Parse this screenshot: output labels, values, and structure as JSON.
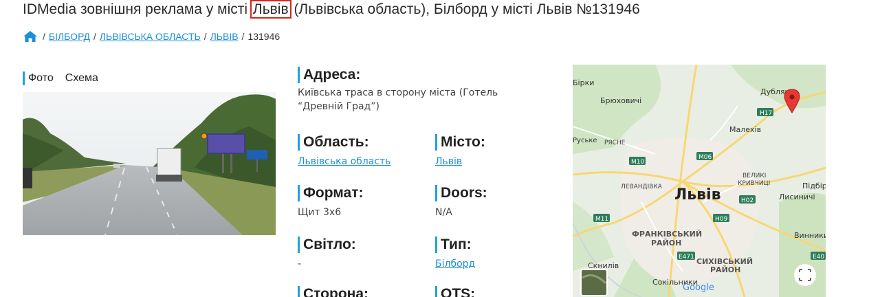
{
  "header": {
    "title_before": "IDMedia зовнішня реклама у місті ",
    "title_highlight": "Львів",
    "title_after": " (Львівська область), Білборд у місті Львів №131946"
  },
  "breadcrumb": {
    "items": [
      "БІЛБОРД",
      "ЛЬВІВСЬКА ОБЛАСТЬ",
      "ЛЬВІВ"
    ],
    "current": "131946",
    "separator": "/"
  },
  "gallery": {
    "tabs": [
      "Фото",
      "Схема"
    ]
  },
  "details": {
    "address": {
      "label": "Адреса:",
      "value": "Київська траса в сторону міста (Готель “Древній Град”)"
    },
    "region": {
      "label": "Область:",
      "value": "Львівська область"
    },
    "city": {
      "label": "Місто:",
      "value": "Львів"
    },
    "format": {
      "label": "Формат:",
      "value": "Щит 3х6"
    },
    "doors": {
      "label": "Doors:",
      "value": "N/A"
    },
    "light": {
      "label": "Світло:",
      "value": "-"
    },
    "type": {
      "label": "Тип:",
      "value": "Білборд"
    },
    "side": {
      "label": "Сторона:"
    },
    "ots": {
      "label": "OTS:"
    }
  },
  "map": {
    "places": {
      "birky": "Бірки",
      "bryukhovychi": "Брюховичі",
      "dublyany": "Дубляни",
      "malekhiv": "Малехів",
      "ruske": "Руське",
      "ryasne": "РЯСНЕ",
      "levandivka": "ЛЕВАНДІВКА",
      "velyki_kryvchytsi_1": "ВЕЛИКІ",
      "velyki_kryvchytsi_2": "КРИВЧИЦІ",
      "lviv": "Львів",
      "lysynychi": "Лисиничі",
      "pidbirtsi": "Підбір",
      "frankivskyi_1": "ФРАНКІВСЬКИЙ",
      "frankivskyi_2": "РАЙОН",
      "sykhivskyi_1": "СИХІВСЬКИЙ",
      "sykhivskyi_2": "РАЙОН",
      "vynnyky": "Винники",
      "sknyliv": "Скнилів",
      "sokilnyky": "Сокільники"
    },
    "roads": [
      "H17",
      "M06",
      "M10",
      "H02",
      "M11",
      "H09",
      "E471",
      "E40"
    ],
    "attribution": "Google",
    "accent_pin": "#e53935",
    "road_shield": "#2e7d5b"
  },
  "colors": {
    "accent_bar": "#1fa0e0",
    "link": "#1a8fd6",
    "highlight_box": "#d9231f"
  }
}
